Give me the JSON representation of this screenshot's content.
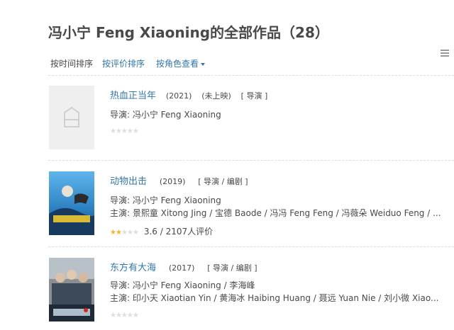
{
  "page": {
    "title": "冯小宁 Feng Xiaoning的全部作品（28）"
  },
  "sort": {
    "by_time": "按时间排序",
    "by_rating": "按评价排序",
    "by_role": "按角色查看"
  },
  "colors": {
    "link": "#3377aa",
    "text": "#494949",
    "star": "#f7b32b"
  },
  "icons": {
    "view_toggle": "list-view-icon",
    "placeholder": "poster-placeholder-icon",
    "caret": "caret-down-icon"
  },
  "works": [
    {
      "title": "热血正当年",
      "year": "(2021)",
      "status": "(未上映)",
      "roles": "[ 导演 ]",
      "director": "导演: 冯小宁 Feng Xiaoning",
      "cast": "",
      "rating": 0,
      "rating_text": ""
    },
    {
      "title": "动物出击",
      "year": "(2019)",
      "status": "",
      "roles": "[ 导演 / 编剧 ]",
      "director": "导演: 冯小宁 Feng Xiaoning",
      "cast": "主演: 景熙童 Xitong Jing / 宝德 Baode / 冯冯 Feng Feng / 冯薇朵 Weiduo Feng / ...",
      "rating": 1.5,
      "rating_text": "3.6 / 2107人评价"
    },
    {
      "title": "东方有大海",
      "year": "(2017)",
      "status": "",
      "roles": "[ 导演 / 编剧 ]",
      "director": "导演: 冯小宁 Feng Xiaoning / 李海峰",
      "cast": "主演: 印小天 Xiaotian Yin / 黄海冰 Haibing Huang / 聂远 Yuan Nie / 刘小微 Xiao...",
      "rating": 0,
      "rating_text": ""
    }
  ]
}
